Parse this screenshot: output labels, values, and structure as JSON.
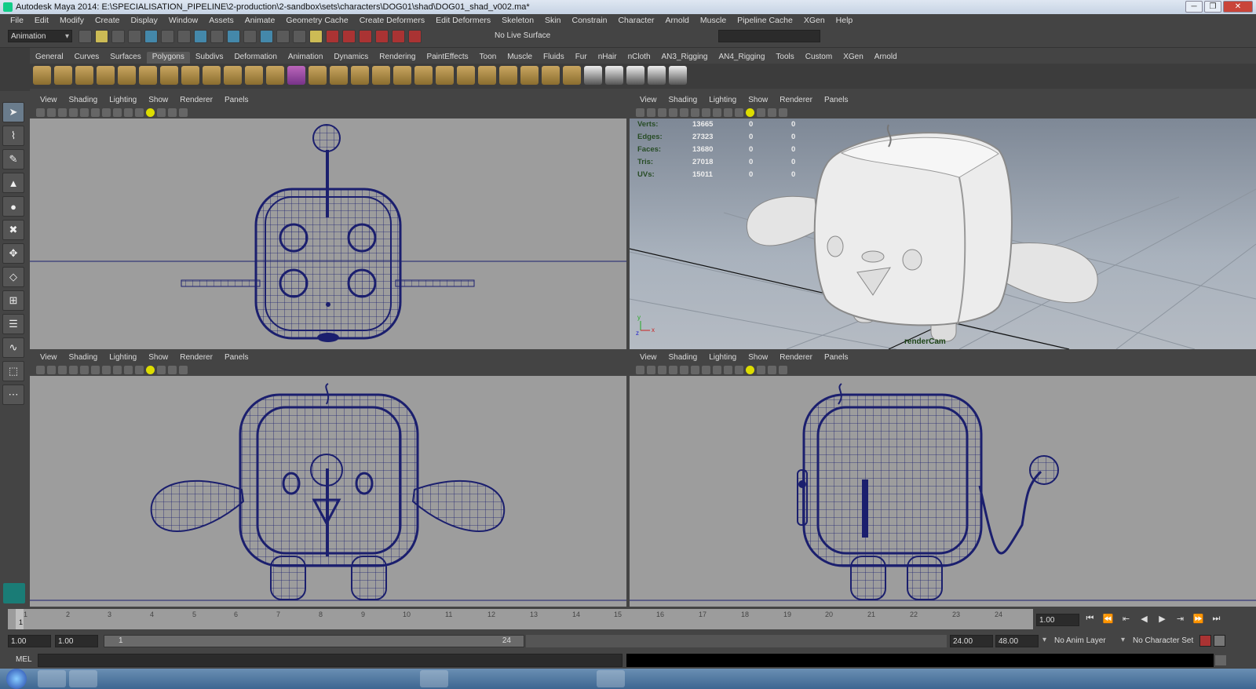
{
  "window": {
    "title": "Autodesk Maya 2014: E:\\SPECIALISATION_PIPELINE\\2-production\\2-sandbox\\sets\\characters\\DOG01\\shad\\DOG01_shad_v002.ma*",
    "minimize": "─",
    "maximize": "❐",
    "close": "✕"
  },
  "menubar": [
    "File",
    "Edit",
    "Modify",
    "Create",
    "Display",
    "Window",
    "Assets",
    "Animate",
    "Geometry Cache",
    "Create Deformers",
    "Edit Deformers",
    "Skeleton",
    "Skin",
    "Constrain",
    "Character",
    "Arnold",
    "Muscle",
    "Pipeline Cache",
    "XGen",
    "Help"
  ],
  "status_line": {
    "mode": "Animation",
    "live_surface": "No Live Surface"
  },
  "shelf_tabs": [
    "General",
    "Curves",
    "Surfaces",
    "Polygons",
    "Subdivs",
    "Deformation",
    "Animation",
    "Dynamics",
    "Rendering",
    "PaintEffects",
    "Toon",
    "Muscle",
    "Fluids",
    "Fur",
    "nHair",
    "nCloth",
    "AN3_Rigging",
    "AN4_Rigging",
    "Tools",
    "Custom",
    "XGen",
    "Arnold"
  ],
  "active_shelf_tab": "Polygons",
  "viewport_menu": [
    "View",
    "Shading",
    "Lighting",
    "Show",
    "Renderer",
    "Panels"
  ],
  "poly_count": {
    "rows": [
      {
        "label": "Verts:",
        "value": "13665",
        "sel": "0",
        "comp": "0"
      },
      {
        "label": "Edges:",
        "value": "27323",
        "sel": "0",
        "comp": "0"
      },
      {
        "label": "Faces:",
        "value": "13680",
        "sel": "0",
        "comp": "0"
      },
      {
        "label": "Tris:",
        "value": "27018",
        "sel": "0",
        "comp": "0"
      },
      {
        "label": "UVs:",
        "value": "15011",
        "sel": "0",
        "comp": "0"
      }
    ]
  },
  "camera_label": "renderCam",
  "timeline": {
    "ticks": [
      "1",
      "2",
      "3",
      "4",
      "5",
      "6",
      "7",
      "8",
      "9",
      "10",
      "11",
      "12",
      "13",
      "14",
      "15",
      "16",
      "17",
      "18",
      "19",
      "20",
      "21",
      "22",
      "23",
      "24"
    ],
    "current_frame_marker": "1",
    "current_frame": "1.00"
  },
  "range": {
    "start": "1.00",
    "anim_start": "1.00",
    "slider_start": "1",
    "slider_end": "24",
    "anim_end": "24.00",
    "end": "48.00",
    "anim_layer": "No Anim Layer",
    "character_set": "No Character Set"
  },
  "command_line": {
    "label": "MEL"
  },
  "colors": {
    "wire": "#1b1f6e",
    "accent": "#1a7c76"
  }
}
